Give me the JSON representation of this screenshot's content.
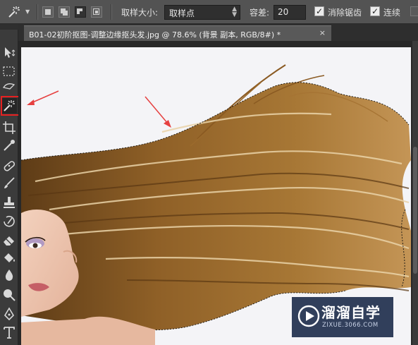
{
  "options_bar": {
    "sample_size_label": "取样大小:",
    "sample_size_value": "取样点",
    "tolerance_label": "容差:",
    "tolerance_value": "20",
    "anti_alias_label": "消除锯齿",
    "anti_alias_checked": true,
    "contiguous_label": "连续",
    "contiguous_checked": true
  },
  "document": {
    "tab_title": "B01-02初阶抠图-调整边缘抠头发.jpg @ 78.6% (背景 副本, RGB/8#) *",
    "close_glyph": "×"
  },
  "toolbar": {
    "active_tool": "magic-wand-icon",
    "tools": [
      "move-icon",
      "marquee-icon",
      "lasso-icon",
      "magic-wand-icon",
      "crop-icon",
      "eyedropper-icon",
      "healing-brush-icon",
      "brush-icon",
      "clone-stamp-icon",
      "history-brush-icon",
      "eraser-icon",
      "paint-bucket-icon",
      "blur-icon",
      "dodge-icon",
      "pen-icon",
      "type-icon"
    ]
  },
  "watermark": {
    "title": "溜溜自学",
    "url": "ZIXUE.3066.COM"
  },
  "colors": {
    "highlight": "#e62020",
    "annotation_arrow": "#e64040",
    "canvas_background": "#f4f4f7",
    "hair_brown": "#8a5a22",
    "hair_highlight": "#e8cfa0"
  }
}
